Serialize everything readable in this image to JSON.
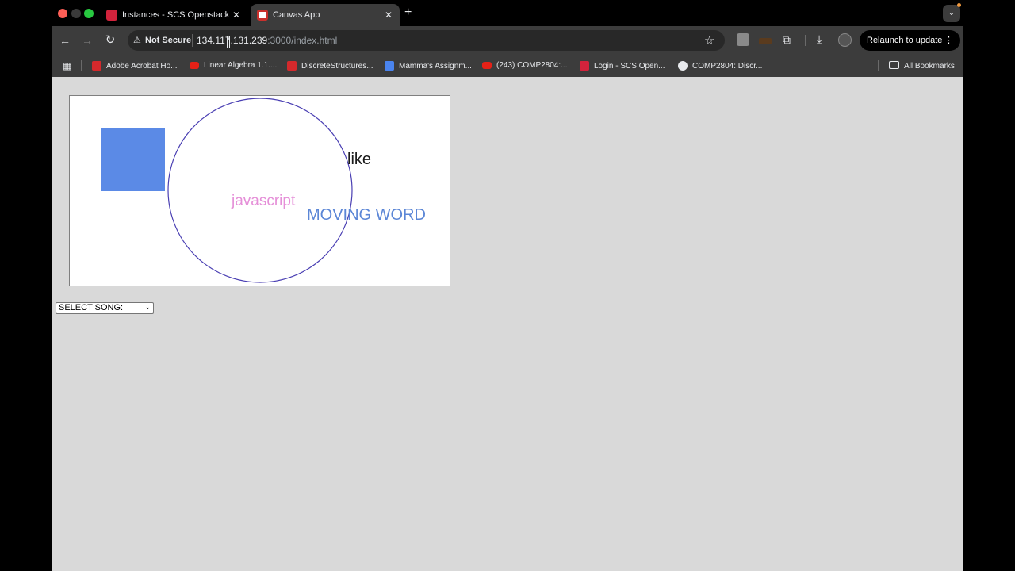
{
  "browser": {
    "tabs": [
      {
        "title": "Instances - SCS Openstack C",
        "active": false
      },
      {
        "title": "Canvas App",
        "active": true
      }
    ],
    "new_tab_label": "+",
    "tab_search_label": "⌄",
    "security": "Not Secure",
    "url_host": "134.117.131.239",
    "url_rest": ":3000/index.html",
    "relaunch_label": "Relaunch to update",
    "bookmarks": [
      {
        "label": "Adobe Acrobat Ho...",
        "icon": "acrobat-icon"
      },
      {
        "label": "Linear Algebra 1.1....",
        "icon": "youtube-icon"
      },
      {
        "label": "DiscreteStructures...",
        "icon": "acrobat-icon"
      },
      {
        "label": "Mamma's Assignm...",
        "icon": "docs-icon"
      },
      {
        "label": "(243) COMP2804:...",
        "icon": "youtube-icon"
      },
      {
        "label": "Login - SCS Open...",
        "icon": "openstack-icon"
      },
      {
        "label": "COMP2804: Discr...",
        "icon": "globe-icon"
      }
    ],
    "all_bookmarks_label": "All Bookmarks"
  },
  "canvas": {
    "words": [
      {
        "text": "like",
        "color": "#1a1a1a"
      },
      {
        "text": "javascript",
        "color": "#e58fd8"
      },
      {
        "text": "MOVING WORD",
        "color": "#5b86d6"
      }
    ],
    "square_color": "#5b8ae6",
    "circle_color": "#4a3fb3"
  },
  "controls": {
    "song_select_value": "SELECT SONG:"
  }
}
